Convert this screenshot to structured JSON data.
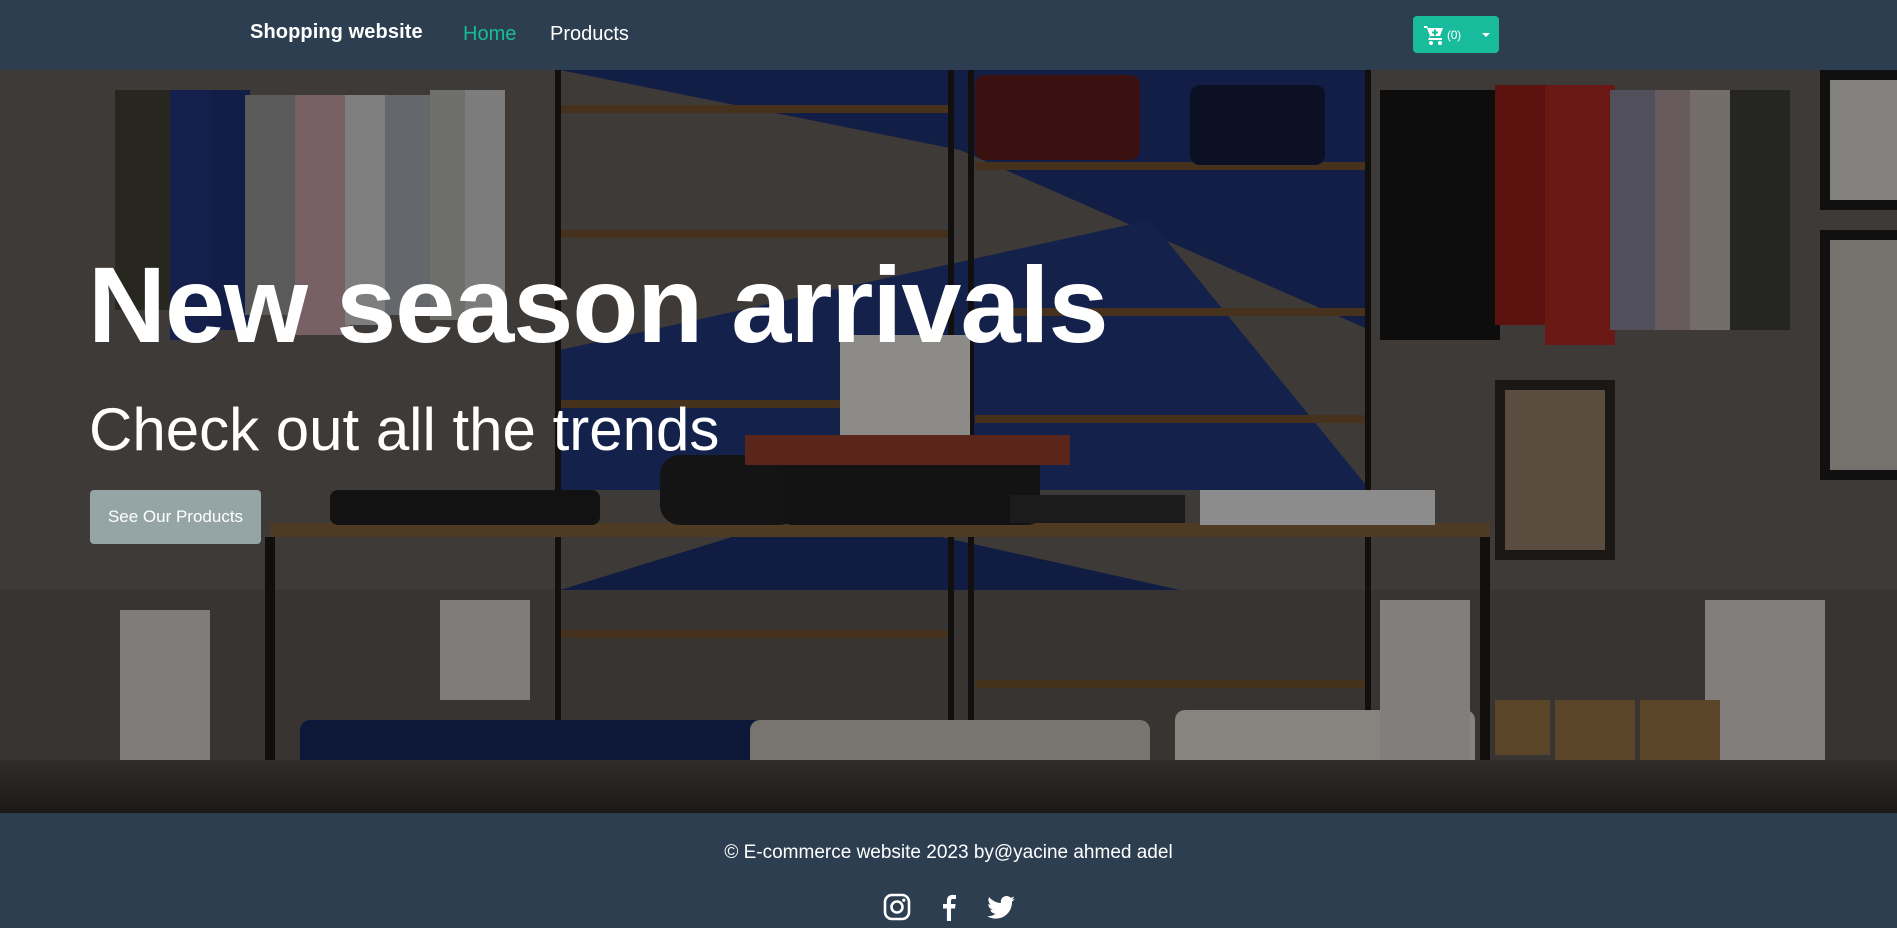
{
  "navbar": {
    "brand": "Shopping website",
    "links": [
      {
        "label": "Home",
        "active": true
      },
      {
        "label": "Products",
        "active": false
      }
    ],
    "cart": {
      "icon": "cart-plus-icon",
      "count_label": "(0)",
      "dropdown_icon": "caret-down-icon"
    }
  },
  "hero": {
    "title": "New season arrivals",
    "subtitle": "Check out all the trends",
    "button_label": "See Our Products"
  },
  "footer": {
    "copyright": "© E-commerce website 2023 by@yacine ahmed adel",
    "social": [
      {
        "icon": "instagram-icon"
      },
      {
        "icon": "facebook-icon"
      },
      {
        "icon": "twitter-icon"
      }
    ]
  },
  "colors": {
    "navbar_bg": "#2c3e50",
    "accent": "#18bc9c",
    "button_secondary": "#95a5a6",
    "text_light": "#ffffff"
  }
}
